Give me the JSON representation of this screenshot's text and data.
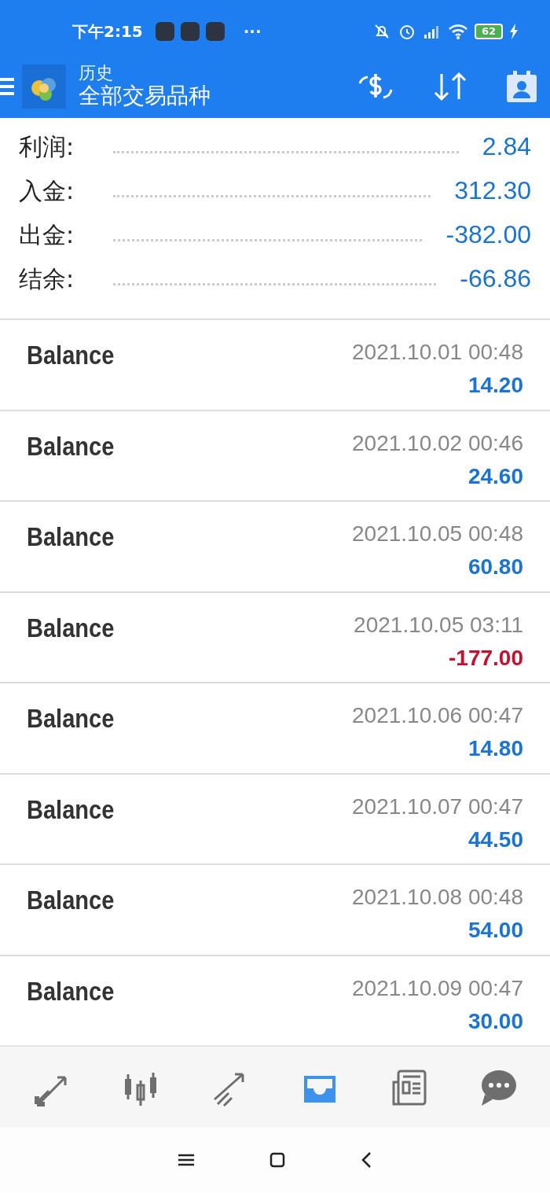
{
  "status_bar": {
    "time": "下午2:15",
    "more": "···",
    "battery": "62"
  },
  "header": {
    "subtitle": "历史",
    "title": "全部交易品种"
  },
  "summary": [
    {
      "label": "利润:",
      "value": "2.84"
    },
    {
      "label": "入金:",
      "value": "312.30"
    },
    {
      "label": "出金:",
      "value": "-382.00"
    },
    {
      "label": "结余:",
      "value": "-66.86"
    }
  ],
  "deals": [
    {
      "type": "Balance",
      "time": "2021.10.01 00:48",
      "amount": "14.20",
      "color": "#1a74d8"
    },
    {
      "type": "Balance",
      "time": "2021.10.02 00:46",
      "amount": "24.60",
      "color": "#1a74d8"
    },
    {
      "type": "Balance",
      "time": "2021.10.05 00:48",
      "amount": "60.80",
      "color": "#1a74d8"
    },
    {
      "type": "Balance",
      "time": "2021.10.05 03:11",
      "amount": "-177.00",
      "color": "#c8102e"
    },
    {
      "type": "Balance",
      "time": "2021.10.06 00:47",
      "amount": "14.80",
      "color": "#1a74d8"
    },
    {
      "type": "Balance",
      "time": "2021.10.07 00:47",
      "amount": "44.50",
      "color": "#1a74d8"
    },
    {
      "type": "Balance",
      "time": "2021.10.08 00:48",
      "amount": "54.00",
      "color": "#1a74d8"
    },
    {
      "type": "Balance",
      "time": "2021.10.09 00:47",
      "amount": "30.00",
      "color": "#1a74d8"
    }
  ],
  "bottom_nav": [
    {
      "kind": "trade",
      "selected": false
    },
    {
      "kind": "chart",
      "selected": false
    },
    {
      "kind": "trend",
      "selected": false
    },
    {
      "kind": "history",
      "selected": true
    },
    {
      "kind": "news",
      "selected": false
    },
    {
      "kind": "chat",
      "selected": false
    }
  ]
}
